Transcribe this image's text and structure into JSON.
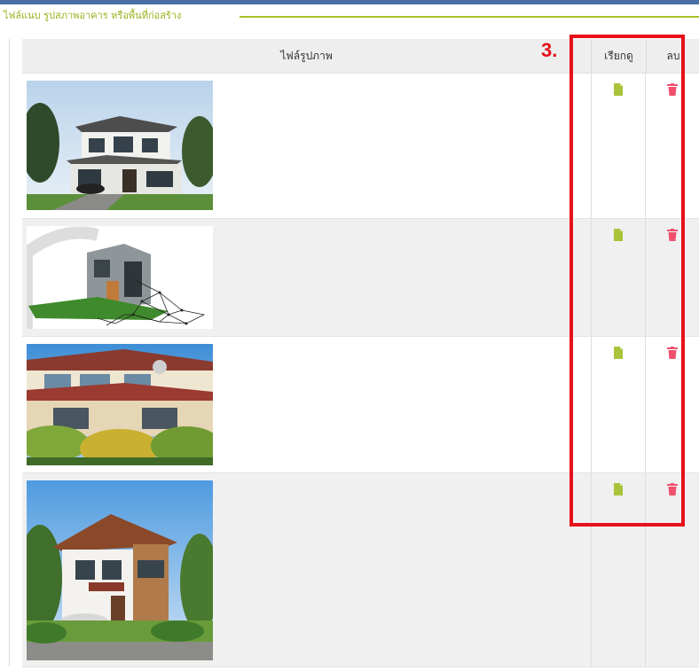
{
  "section": {
    "title": "ไฟล์แนบ รูปสภาพอาคาร หรือพื้นที่ก่อสร้าง"
  },
  "table": {
    "headers": {
      "file": "ไฟล์รูปภาพ",
      "view": "เรียกดู",
      "delete": "ลบ"
    },
    "rows": [
      {
        "image": "house-image-1",
        "view_icon": "document-icon",
        "delete_icon": "trash-icon"
      },
      {
        "image": "house-image-2",
        "view_icon": "document-icon",
        "delete_icon": "trash-icon"
      },
      {
        "image": "house-image-3",
        "view_icon": "document-icon",
        "delete_icon": "trash-icon"
      },
      {
        "image": "house-image-4",
        "view_icon": "document-icon",
        "delete_icon": "trash-icon"
      }
    ]
  },
  "annotation": {
    "label": "3."
  },
  "colors": {
    "accent_green": "#9ab21e",
    "view_icon": "#a9c43a",
    "delete_icon": "#f0506e",
    "annotation_red": "#e8101a",
    "top_bar": "#4a6fa8"
  }
}
